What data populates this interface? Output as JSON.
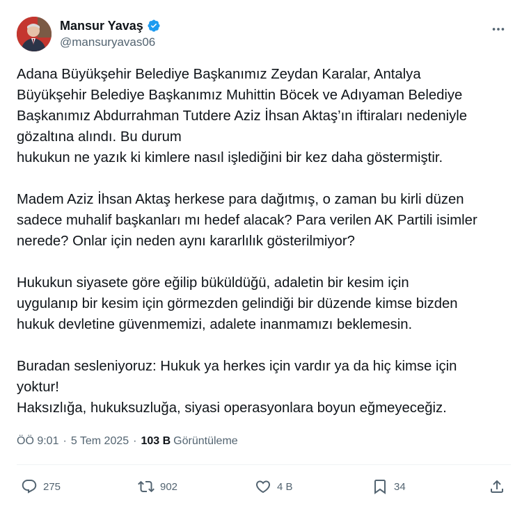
{
  "author": {
    "name": "Mansur Yavaş",
    "handle": "@mansuryavas06",
    "verified": true,
    "verified_color": "#1d9bf0"
  },
  "tweet": {
    "text": "Adana Büyükşehir Belediye Başkanımız Zeydan Karalar, Antalya\nBüyükşehir Belediye Başkanımız Muhittin Böcek ve Adıyaman Belediye\nBaşkanımız Abdurrahman Tutdere Aziz İhsan Aktaş’ın iftiraları nedeniyle\ngözaltına alındı. Bu durum\nhukukun ne yazık ki kimlere nasıl işlediğini bir kez daha göstermiştir.\n\nMadem Aziz İhsan Aktaş herkese para dağıtmış, o zaman bu kirli düzen\nsadece muhalif başkanları mı hedef alacak? Para verilen AK Partili isimler\nnerede? Onlar için neden aynı kararlılık gösterilmiyor?\n\nHukukun siyasete göre eğilip büküldüğü, adaletin bir kesim için\nuygulanıp bir kesim için görmezden gelindiği bir düzende kimse bizden\nhukuk devletine güvenmemizi, adalete inanmamızı beklemesin.\n\nBuradan sesleniyoruz: Hukuk ya herkes için vardır ya da hiç kimse için\nyoktur!\nHaksızlığa, hukuksuzluğa, siyasi operasyonlara boyun eğmeyeceğiz."
  },
  "meta": {
    "time": "ÖÖ 9:01",
    "separator": "·",
    "date": "5 Tem 2025",
    "views_count": "103 B",
    "views_label": "Görüntüleme"
  },
  "actions": {
    "replies": "275",
    "reposts": "902",
    "likes": "4 B",
    "bookmarks": "34"
  },
  "icons": {
    "more": "more-dots-icon",
    "reply": "reply-icon",
    "repost": "repost-icon",
    "like": "heart-icon",
    "bookmark": "bookmark-icon",
    "share": "share-icon"
  }
}
